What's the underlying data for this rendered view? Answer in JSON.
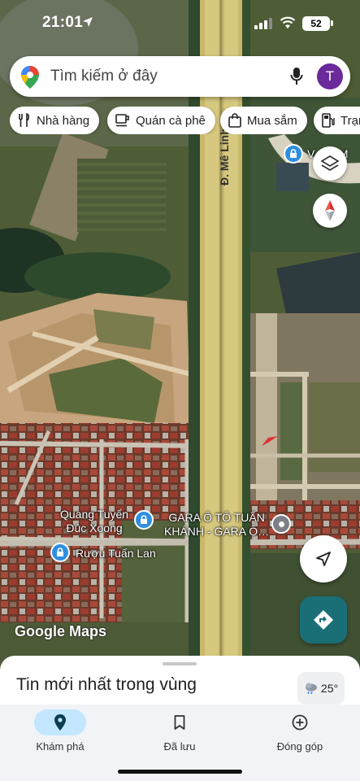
{
  "status_bar": {
    "time": "21:01",
    "battery": "52"
  },
  "search": {
    "placeholder": "Tìm kiếm ở đây",
    "avatar_letter": "T"
  },
  "chips": [
    {
      "label": "Nhà hàng",
      "icon": "fork-knife-icon"
    },
    {
      "label": "Quán cà phê",
      "icon": "coffee-cup-icon"
    },
    {
      "label": "Mua sắm",
      "icon": "shopping-bag-icon"
    },
    {
      "label": "Trạm",
      "icon": "gas-station-icon"
    }
  ],
  "map": {
    "road_label": "Đ. Mê Linh",
    "poi_partial": "V… e M",
    "places": [
      {
        "name_line1": "Quang Tuyển",
        "name_line2": "Đúc Xoong"
      },
      {
        "name_line1": "Rượu Tuấn Lan"
      },
      {
        "name_line1": "GARA Ô TÔ TUẤN",
        "name_line2": "KHÁNH - GARA Ô…"
      }
    ],
    "attribution": "Google Maps"
  },
  "sheet": {
    "title": "Tin mới nhất trong vùng",
    "temperature": "25°"
  },
  "nav": [
    {
      "label": "Khám phá",
      "icon": "explore-pin-icon",
      "active": true
    },
    {
      "label": "Đã lưu",
      "icon": "bookmark-icon",
      "active": false
    },
    {
      "label": "Đóng góp",
      "icon": "add-circle-icon",
      "active": false
    }
  ],
  "colors": {
    "accent": "#1a6f76",
    "nav_active": "#c2e7ff",
    "avatar": "#6a2a9a",
    "poi": "#2f8fe0"
  }
}
